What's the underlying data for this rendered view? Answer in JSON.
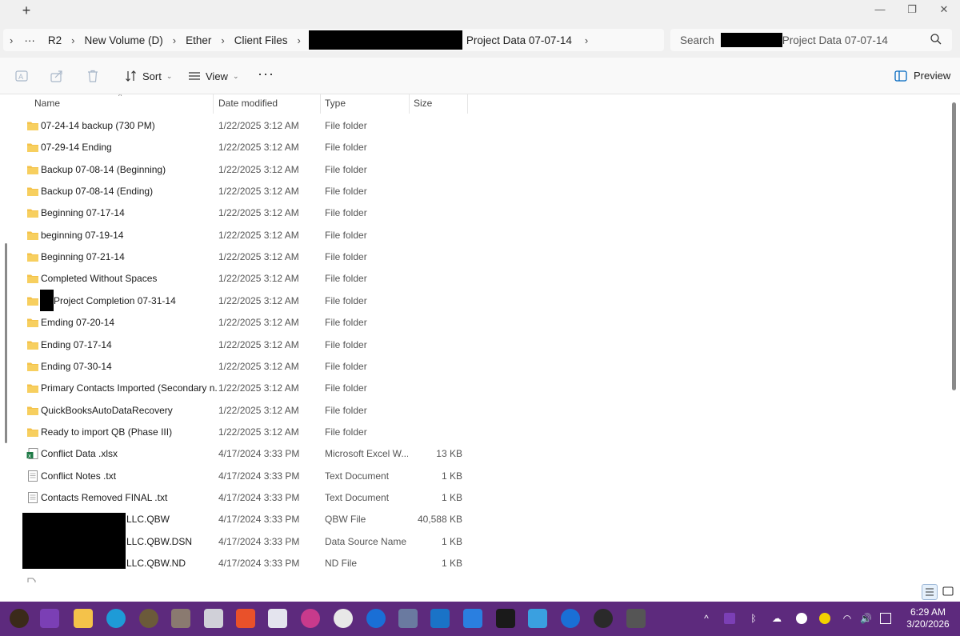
{
  "window": {
    "new_tab": "+",
    "minimize": "—",
    "maximize": "❐",
    "close": "✕"
  },
  "address": {
    "expand": "›",
    "more": "···",
    "crumbs": [
      "R2",
      "New Volume (D)",
      "Ether",
      "Client Files",
      "Project Data 07-07-14"
    ],
    "trailing_chevron": "›"
  },
  "search": {
    "label": "Search",
    "scope": "Project Data 07-07-14"
  },
  "toolbar": {
    "sort_label": "Sort",
    "view_label": "View",
    "more": "···",
    "preview_label": "Preview"
  },
  "columns": {
    "name": "Name",
    "date": "Date modified",
    "type": "Type",
    "size": "Size"
  },
  "files": [
    {
      "name": "07-24-14 backup (730 PM)",
      "date": "1/22/2025 3:12 AM",
      "type": "File folder",
      "size": "",
      "icon": "folder"
    },
    {
      "name": "07-29-14 Ending",
      "date": "1/22/2025 3:12 AM",
      "type": "File folder",
      "size": "",
      "icon": "folder"
    },
    {
      "name": "Backup 07-08-14 (Beginning)",
      "date": "1/22/2025 3:12 AM",
      "type": "File folder",
      "size": "",
      "icon": "folder"
    },
    {
      "name": "Backup 07-08-14 (Ending)",
      "date": "1/22/2025 3:12 AM",
      "type": "File folder",
      "size": "",
      "icon": "folder"
    },
    {
      "name": "Beginning 07-17-14",
      "date": "1/22/2025 3:12 AM",
      "type": "File folder",
      "size": "",
      "icon": "folder"
    },
    {
      "name": "beginning 07-19-14",
      "date": "1/22/2025 3:12 AM",
      "type": "File folder",
      "size": "",
      "icon": "folder"
    },
    {
      "name": "Beginning 07-21-14",
      "date": "1/22/2025 3:12 AM",
      "type": "File folder",
      "size": "",
      "icon": "folder"
    },
    {
      "name": "Completed Without Spaces",
      "date": "1/22/2025 3:12 AM",
      "type": "File folder",
      "size": "",
      "icon": "folder"
    },
    {
      "name": "Project Completion 07-31-14",
      "date": "1/22/2025 3:12 AM",
      "type": "File folder",
      "size": "",
      "icon": "folder"
    },
    {
      "name": "Emding 07-20-14",
      "date": "1/22/2025 3:12 AM",
      "type": "File folder",
      "size": "",
      "icon": "folder"
    },
    {
      "name": "Ending 07-17-14",
      "date": "1/22/2025 3:12 AM",
      "type": "File folder",
      "size": "",
      "icon": "folder"
    },
    {
      "name": "Ending 07-30-14",
      "date": "1/22/2025 3:12 AM",
      "type": "File folder",
      "size": "",
      "icon": "folder"
    },
    {
      "name": "Primary Contacts Imported (Secondary n...",
      "date": "1/22/2025 3:12 AM",
      "type": "File folder",
      "size": "",
      "icon": "folder"
    },
    {
      "name": "QuickBooksAutoDataRecovery",
      "date": "1/22/2025 3:12 AM",
      "type": "File folder",
      "size": "",
      "icon": "folder"
    },
    {
      "name": "Ready to import QB (Phase III)",
      "date": "1/22/2025 3:12 AM",
      "type": "File folder",
      "size": "",
      "icon": "folder"
    },
    {
      "name": "Conflict Data .xlsx",
      "date": "4/17/2024 3:33 PM",
      "type": "Microsoft Excel W...",
      "size": "13 KB",
      "icon": "excel"
    },
    {
      "name": "Conflict Notes .txt",
      "date": "4/17/2024 3:33 PM",
      "type": "Text Document",
      "size": "1 KB",
      "icon": "text"
    },
    {
      "name": "Contacts Removed FINAL .txt",
      "date": "4/17/2024 3:33 PM",
      "type": "Text Document",
      "size": "1 KB",
      "icon": "text"
    },
    {
      "name": "LLC.QBW",
      "date": "4/17/2024 3:33 PM",
      "type": "QBW File",
      "size": "40,588 KB",
      "icon": "file"
    },
    {
      "name": "LLC.QBW.DSN",
      "date": "4/17/2024 3:33 PM",
      "type": "Data Source Name",
      "size": "1 KB",
      "icon": "file"
    },
    {
      "name": "LLC.QBW.ND",
      "date": "4/17/2024 3:33 PM",
      "type": "ND File",
      "size": "1 KB",
      "icon": "file"
    }
  ],
  "clock": {
    "time": "6:29 AM",
    "date": "3/20/2026"
  },
  "colors": {
    "taskbar": "#5d2a7d",
    "folder": "#f4c24a",
    "accent": "#0067c0"
  }
}
